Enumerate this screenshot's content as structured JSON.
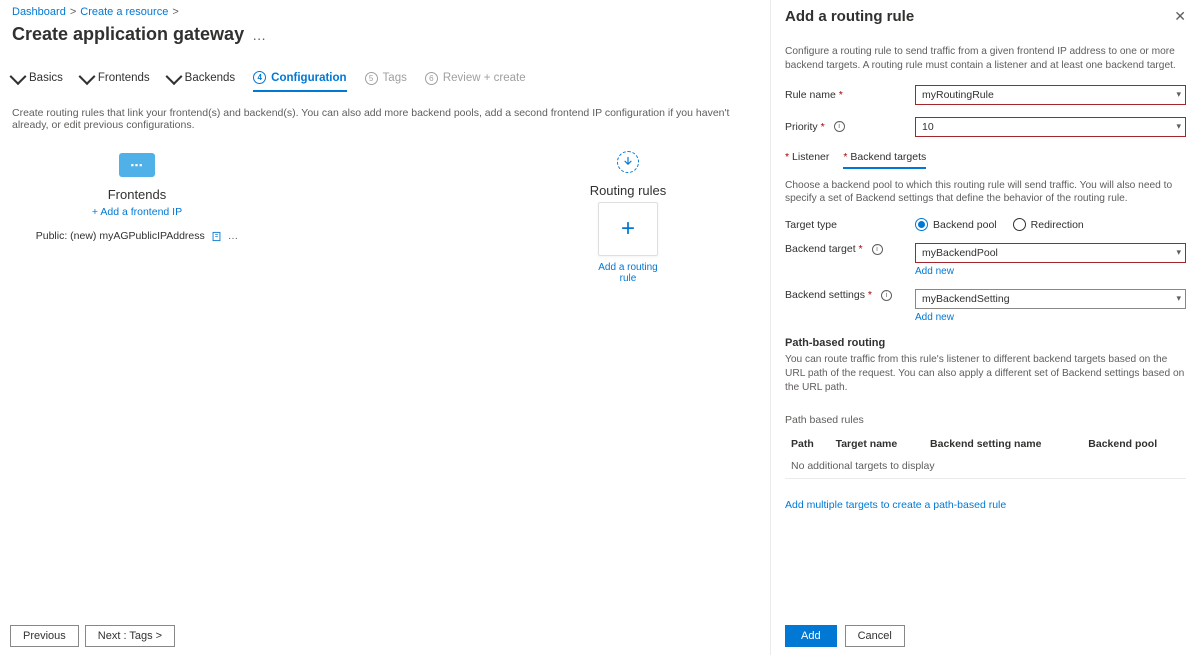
{
  "breadcrumb": {
    "dashboard": "Dashboard",
    "create_resource": "Create a resource"
  },
  "page_title": "Create application gateway",
  "tabs": {
    "basics": "Basics",
    "frontends": "Frontends",
    "backends": "Backends",
    "configuration": "Configuration",
    "tags_num": "5",
    "tags": "Tags",
    "review_num": "6",
    "review": "Review + create"
  },
  "main_desc": "Create routing rules that link your frontend(s) and backend(s). You can also add more backend pools, add a second frontend IP configuration if you haven't already, or edit previous configurations.",
  "frontends": {
    "title": "Frontends",
    "add_link": "+ Add a frontend IP",
    "row_label": "Public: (new) myAGPublicIPAddress"
  },
  "routing": {
    "title": "Routing rules",
    "add_link": "Add a routing rule"
  },
  "footer": {
    "previous": "Previous",
    "next": "Next : Tags >"
  },
  "panel": {
    "title": "Add a routing rule",
    "intro": "Configure a routing rule to send traffic from a given frontend IP address to one or more backend targets. A routing rule must contain a listener and at least one backend target.",
    "rule_name_lbl": "Rule name",
    "rule_name_val": "myRoutingRule",
    "priority_lbl": "Priority",
    "priority_val": "10",
    "sub_listener": "Listener",
    "sub_backend": "Backend targets",
    "sub_desc": "Choose a backend pool to which this routing rule will send traffic. You will also need to specify a set of Backend settings that define the behavior of the routing rule.",
    "target_type_lbl": "Target type",
    "opt_pool": "Backend pool",
    "opt_redirect": "Redirection",
    "backend_target_lbl": "Backend target",
    "backend_target_val": "myBackendPool",
    "backend_settings_lbl": "Backend settings",
    "backend_settings_val": "myBackendSetting",
    "add_new": "Add new",
    "path_heading": "Path-based routing",
    "path_desc": "You can route traffic from this rule's listener to different backend targets based on the URL path of the request. You can also apply a different set of Backend settings based on the URL path.",
    "tbl_caption": "Path based rules",
    "th_path": "Path",
    "th_target": "Target name",
    "th_setting": "Backend setting name",
    "th_pool": "Backend pool",
    "tbl_empty": "No additional targets to display",
    "add_multiple": "Add multiple targets to create a path-based rule",
    "add_btn": "Add",
    "cancel_btn": "Cancel"
  }
}
